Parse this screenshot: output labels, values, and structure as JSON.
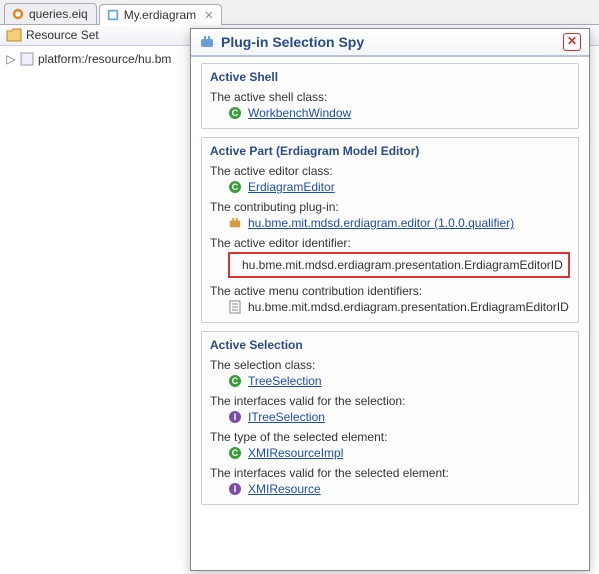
{
  "tabs": [
    {
      "label": "queries.eiq"
    },
    {
      "label": "My.erdiagram"
    }
  ],
  "resource_bar": "Resource Set",
  "tree_item": "platform:/resource/hu.bm",
  "popup": {
    "title": "Plug-in Selection Spy",
    "sections": {
      "shell": {
        "title": "Active Shell",
        "rows": [
          {
            "label": "The active shell class:",
            "value": "WorkbenchWindow",
            "icon": "class",
            "link": true
          }
        ]
      },
      "part": {
        "title": "Active Part (Erdiagram Model Editor)",
        "rows": [
          {
            "label": "The active editor class:",
            "value": "ErdiagramEditor",
            "icon": "class",
            "link": true
          },
          {
            "label": "The contributing plug-in:",
            "value": "hu.bme.mit.mdsd.erdiagram.editor (1.0.0.qualifier)",
            "icon": "plugin",
            "link": true
          },
          {
            "label": "The active editor identifier:",
            "value": "hu.bme.mit.mdsd.erdiagram.presentation.ErdiagramEditorID",
            "icon": "id",
            "link": false,
            "highlight": true
          },
          {
            "label": "The active menu contribution identifiers:",
            "value": "hu.bme.mit.mdsd.erdiagram.presentation.ErdiagramEditorID",
            "icon": "doc",
            "link": false
          }
        ]
      },
      "selection": {
        "title": "Active Selection",
        "rows": [
          {
            "label": "The selection class:",
            "value": "TreeSelection",
            "icon": "class",
            "link": true
          },
          {
            "label": "The interfaces valid for the selection:",
            "value": "ITreeSelection",
            "icon": "interface",
            "link": true
          },
          {
            "label": "The type of the selected element:",
            "value": "XMIResourceImpl",
            "icon": "class",
            "link": true
          },
          {
            "label": "The interfaces valid for the selected element:",
            "value": "XMIResource",
            "icon": "interface",
            "link": true
          }
        ]
      }
    }
  }
}
